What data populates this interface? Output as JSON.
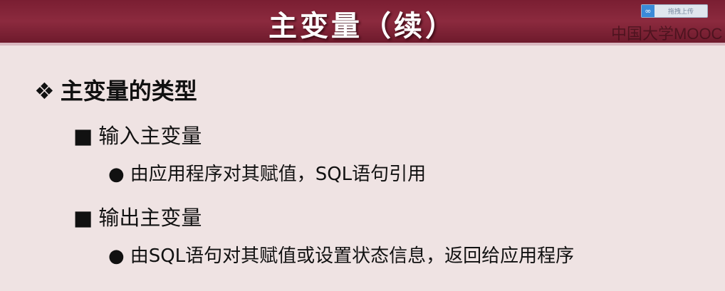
{
  "slide": {
    "title": "主变量（续）",
    "items": [
      {
        "bullet": "❖",
        "text": "主变量的类型"
      },
      {
        "bullet": "■",
        "text": "输入主变量"
      },
      {
        "bullet": "●",
        "text": "由应用程序对其赋值，SQL语句引用"
      },
      {
        "bullet": "■",
        "text": "输出主变量"
      },
      {
        "bullet": "●",
        "text": "由SQL语句对其赋值或设置状态信息，返回给应用程序"
      }
    ]
  },
  "overlay": {
    "upload_label": "拖拽上传",
    "upload_icon": "cloud-link-icon",
    "watermark": "中国大学MOOC"
  }
}
